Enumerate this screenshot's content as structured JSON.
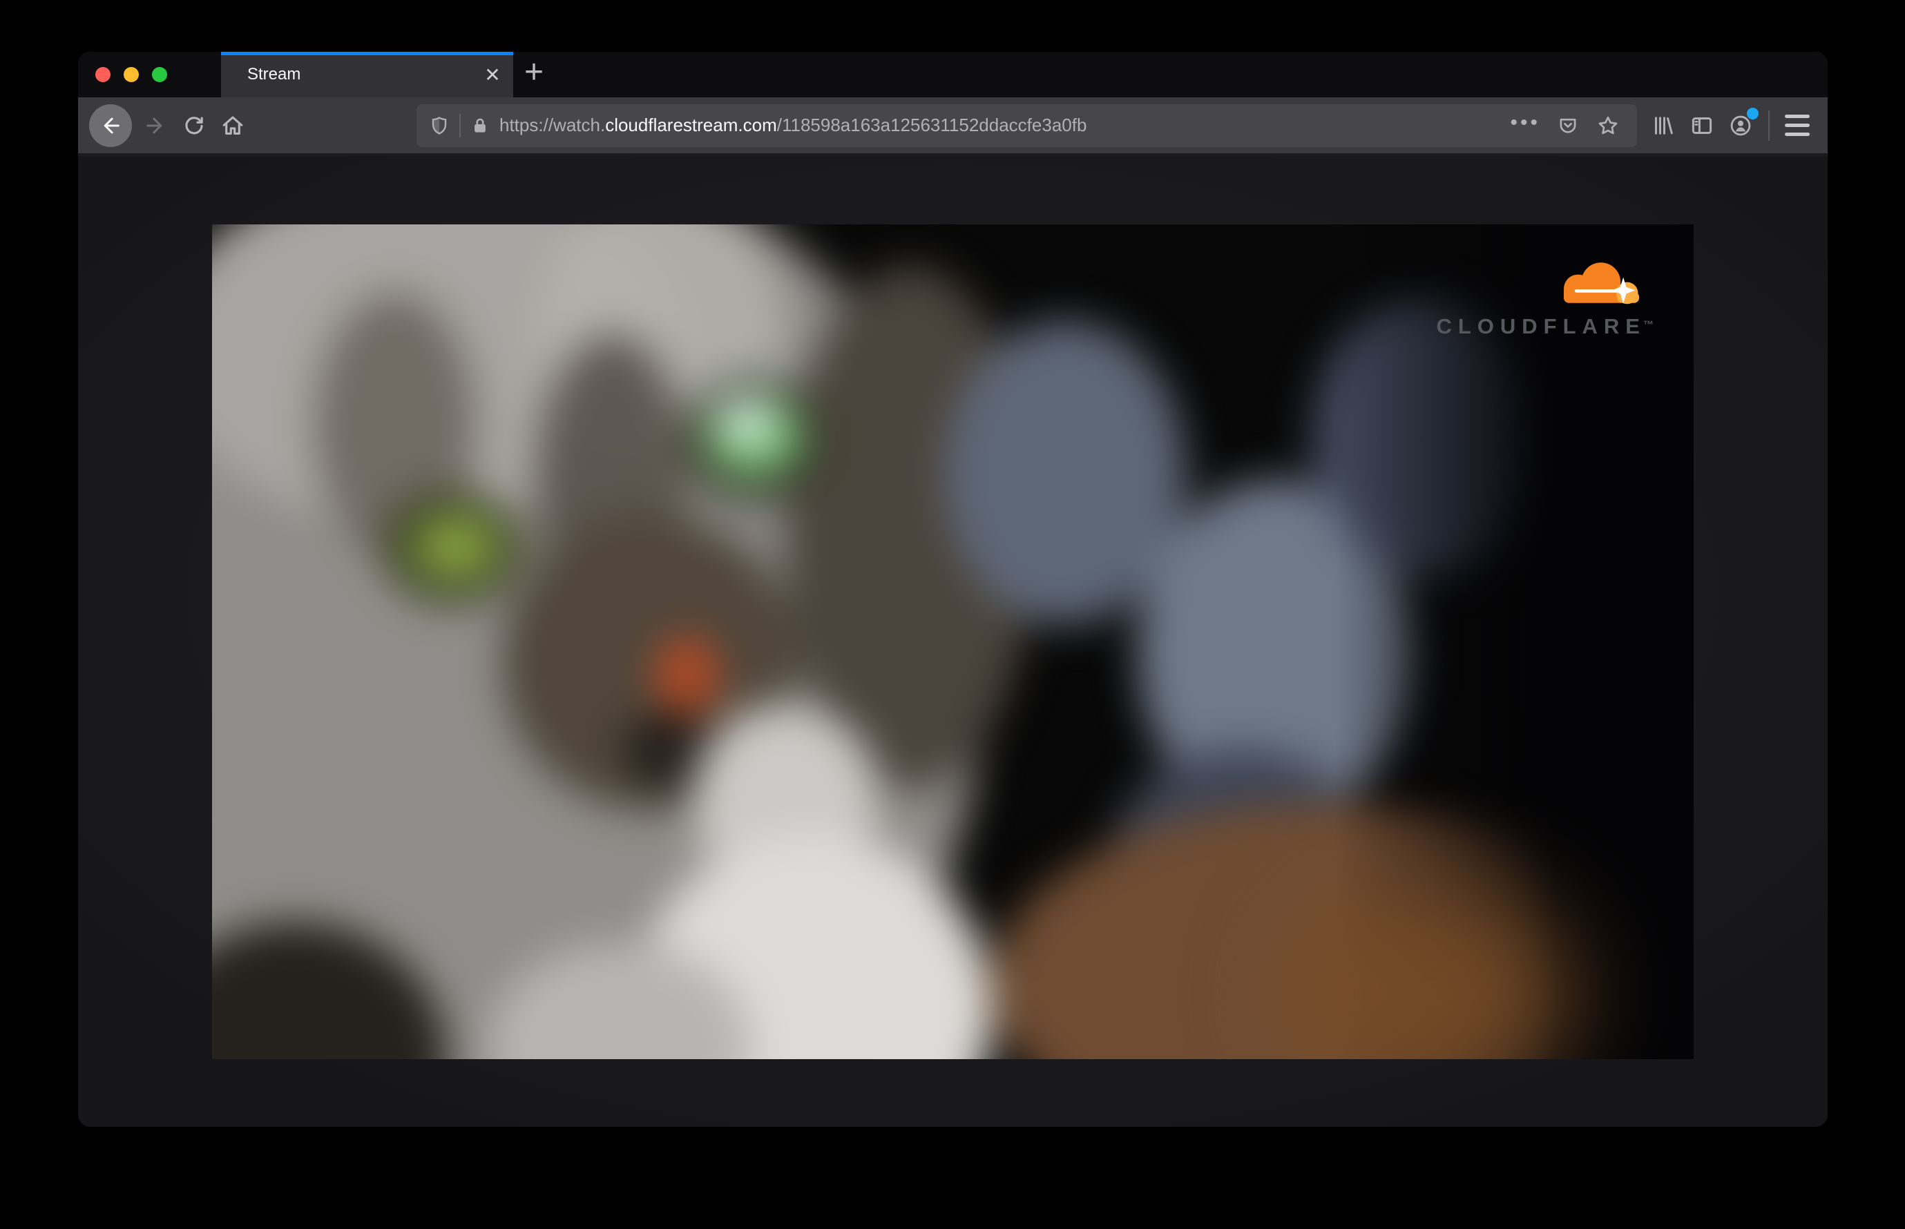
{
  "browser": {
    "tab": {
      "title": "Stream"
    },
    "controls": {
      "close_tab_glyph": "✕",
      "new_tab_glyph": "+",
      "page_actions_glyph": "•••"
    },
    "address_bar": {
      "url_prefix": "https://watch.",
      "url_domain": "cloudflarestream.com",
      "url_path": "/118598a163a125631152ddaccfe3a0fb"
    },
    "icons": [
      "back-icon",
      "forward-icon",
      "reload-icon",
      "home-icon",
      "tracking-protection-shield-icon",
      "lock-icon",
      "page-actions-icon",
      "pocket-icon",
      "bookmark-star-icon",
      "library-icon",
      "sidebar-icon",
      "account-icon",
      "menu-icon",
      "close-icon",
      "new-tab-icon"
    ],
    "colors": {
      "active_tab_accent": "#0a84ff",
      "account_badge": "#1ba7f2",
      "traffic_close": "#ff5f57",
      "traffic_minimize": "#febc2e",
      "traffic_zoom": "#28c840"
    }
  },
  "player": {
    "brand": {
      "wordmark": "CLOUDFLARE",
      "trademark_glyph": "™",
      "cloud_color": "#f6821f",
      "cloud_highlight_color": "#fbad41",
      "wordmark_color": "#56585d"
    },
    "video_subject": "blurred close-up of a gray tabby cat with green eyes"
  }
}
